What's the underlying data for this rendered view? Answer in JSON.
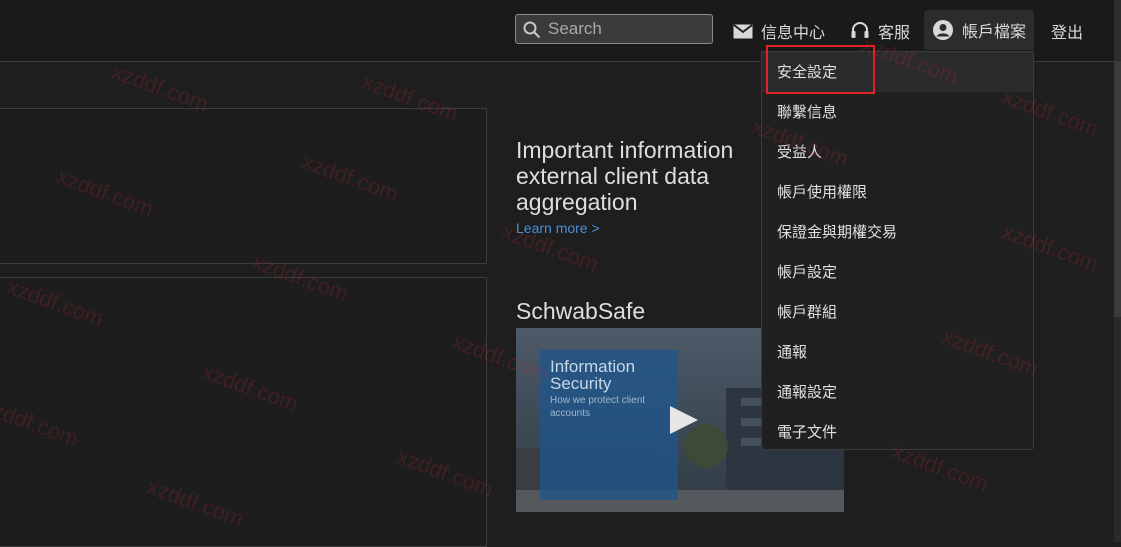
{
  "header": {
    "search_placeholder": "Search",
    "messages_label": "信息中心",
    "service_label": "客服",
    "account_label": "帳戶檔案",
    "logout_label": "登出"
  },
  "account_menu": {
    "items": [
      "安全設定",
      "聯繫信息",
      "受益人",
      "帳戶使用權限",
      "保證金與期權交易",
      "帳戶設定",
      "帳戶群組",
      "通報",
      "通報設定",
      "電子文件"
    ],
    "highlighted_index": 0
  },
  "main": {
    "info_title": "Important information external client data aggregation",
    "learn_more": "Learn more >",
    "schwabsafe_title": "SchwabSafe",
    "video": {
      "card_title": "Information Security",
      "card_subtitle": "How we protect client accounts"
    }
  },
  "watermark": "xzddf.com",
  "colors": {
    "background": "#1e1e1f",
    "link": "#4a90d9",
    "highlight_box": "#e0232b"
  }
}
